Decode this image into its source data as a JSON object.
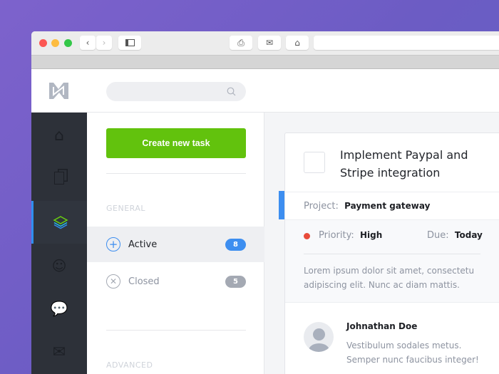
{
  "browser": {
    "back": "‹",
    "forward": "›"
  },
  "sidebar": {
    "items": [
      {
        "name": "home"
      },
      {
        "name": "documents"
      },
      {
        "name": "layers",
        "active": true
      },
      {
        "name": "users"
      },
      {
        "name": "chat"
      },
      {
        "name": "mail"
      }
    ]
  },
  "list": {
    "create_label": "Create new task",
    "general_label": "GENERAL",
    "advanced_label": "ADVANCED",
    "items": [
      {
        "label": "Active",
        "count": "8"
      },
      {
        "label": "Closed",
        "count": "5"
      }
    ]
  },
  "task": {
    "title": "Implement Paypal and Stripe integration",
    "project_label": "Project:",
    "project": "Payment gateway",
    "priority_label": "Priority:",
    "priority": "High",
    "due_label": "Due:",
    "due": "Today",
    "description": "Lorem ipsum dolor sit amet, consectetu adipiscing elit. Nunc ac diam mattis.",
    "comment": {
      "author": "Johnathan Doe",
      "text": "Vestibulum sodales metus. Semper nunc faucibus integer!"
    }
  },
  "colors": {
    "accent": "#3d8ef0",
    "green": "#62c20d",
    "priority_high": "#e84b3a"
  }
}
